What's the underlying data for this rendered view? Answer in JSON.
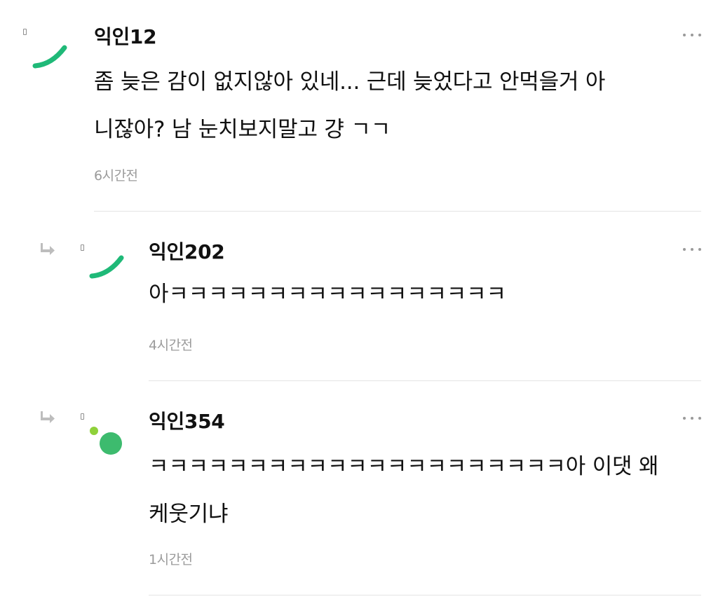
{
  "comments": [
    {
      "nickname": "익인12",
      "text": "좀 늦은 감이 없지않아 있네... 근데 늦었다고 안먹을거 아\n니잖아? 남 눈치보지말고 걍 ㄱㄱ",
      "time": "6시간전",
      "is_reply": false,
      "avatar": "green-arc"
    },
    {
      "nickname": "익인202",
      "text": "아ㅋㅋㅋㅋㅋㅋㅋㅋㅋㅋㅋㅋㅋㅋㅋㅋㅋ",
      "time": "4시간전",
      "is_reply": true,
      "avatar": "green-arc"
    },
    {
      "nickname": "익인354",
      "text": "ㅋㅋㅋㅋㅋㅋㅋㅋㅋㅋㅋㅋㅋㅋㅋㅋㅋㅋㅋㅋㅋ아 이댓 왜\n케웃기냐",
      "time": "1시간전",
      "is_reply": true,
      "avatar": "green-dots"
    }
  ],
  "icons": {
    "more": "more-dots-icon",
    "reply": "reply-arrow-icon",
    "level": "level-badge-icon"
  },
  "colors": {
    "avatar_green": "#1fb978",
    "avatar_light_green": "#8fd13a",
    "avatar_dot_green": "#3dbb6e",
    "time_gray": "#9b9b9b",
    "divider": "#e4e4e4"
  }
}
